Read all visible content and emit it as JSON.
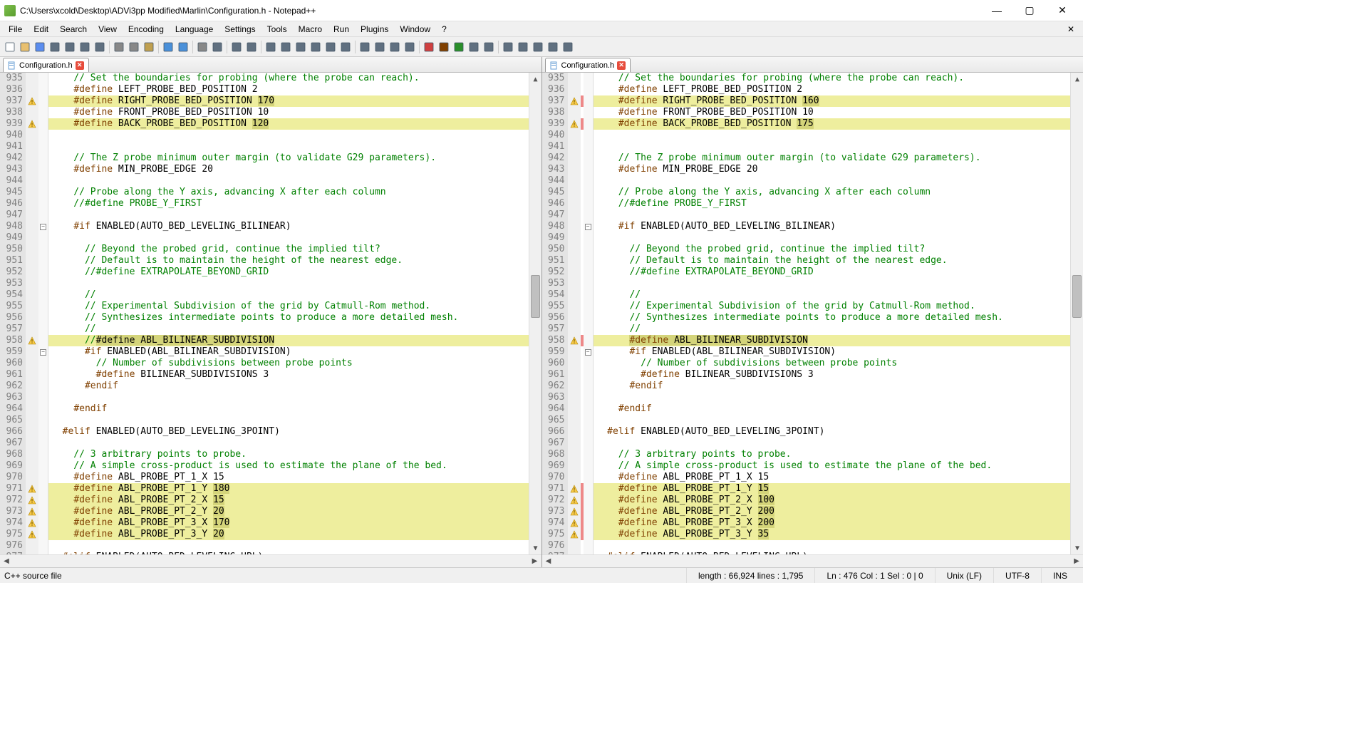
{
  "title": "C:\\Users\\xcold\\Desktop\\ADVi3pp Modified\\Marlin\\Configuration.h - Notepad++",
  "menus": [
    "File",
    "Edit",
    "Search",
    "View",
    "Encoding",
    "Language",
    "Settings",
    "Tools",
    "Macro",
    "Run",
    "Plugins",
    "Window",
    "?"
  ],
  "tab_label": "Configuration.h",
  "status": {
    "filetype": "C++ source file",
    "length": "length : 66,924    lines : 1,795",
    "pos": "Ln : 476   Col : 1   Sel : 0 | 0",
    "eol": "Unix (LF)",
    "enc": "UTF-8",
    "mode": "INS"
  },
  "line_start": 935,
  "line_end": 977,
  "left_lines": [
    {
      "n": 935,
      "t": "comment",
      "text": "    // Set the boundaries for probing (where the probe can reach)."
    },
    {
      "n": 936,
      "t": "define",
      "text": "    #define LEFT_PROBE_BED_POSITION 2"
    },
    {
      "n": 937,
      "t": "define",
      "text": "    #define RIGHT_PROBE_BED_POSITION ",
      "tail": "170",
      "hl": true,
      "warn": true
    },
    {
      "n": 938,
      "t": "define",
      "text": "    #define FRONT_PROBE_BED_POSITION 10"
    },
    {
      "n": 939,
      "t": "define",
      "text": "    #define BACK_PROBE_BED_POSITION ",
      "tail": "120",
      "hl": true,
      "warn": true
    },
    {
      "n": 940,
      "t": "blank",
      "text": ""
    },
    {
      "n": 941,
      "t": "blank",
      "text": ""
    },
    {
      "n": 942,
      "t": "comment",
      "text": "    // The Z probe minimum outer margin (to validate G29 parameters)."
    },
    {
      "n": 943,
      "t": "define",
      "text": "    #define MIN_PROBE_EDGE 20"
    },
    {
      "n": 944,
      "t": "blank",
      "text": ""
    },
    {
      "n": 945,
      "t": "comment",
      "text": "    // Probe along the Y axis, advancing X after each column"
    },
    {
      "n": 946,
      "t": "comment",
      "text": "    //#define PROBE_Y_FIRST"
    },
    {
      "n": 947,
      "t": "blank",
      "text": ""
    },
    {
      "n": 948,
      "t": "pre",
      "text": "    #if ENABLED(AUTO_BED_LEVELING_BILINEAR)",
      "fold": "minus"
    },
    {
      "n": 949,
      "t": "blank",
      "text": ""
    },
    {
      "n": 950,
      "t": "comment",
      "text": "      // Beyond the probed grid, continue the implied tilt?"
    },
    {
      "n": 951,
      "t": "comment",
      "text": "      // Default is to maintain the height of the nearest edge."
    },
    {
      "n": 952,
      "t": "comment",
      "text": "      //#define EXTRAPOLATE_BEYOND_GRID"
    },
    {
      "n": 953,
      "t": "blank",
      "text": ""
    },
    {
      "n": 954,
      "t": "comment",
      "text": "      //"
    },
    {
      "n": 955,
      "t": "comment",
      "text": "      // Experimental Subdivision of the grid by Catmull-Rom method."
    },
    {
      "n": 956,
      "t": "comment",
      "text": "      // Synthesizes intermediate points to produce a more detailed mesh."
    },
    {
      "n": 957,
      "t": "comment",
      "text": "      //"
    },
    {
      "n": 958,
      "t": "comment",
      "text": "      //",
      "tail": "#define ABL_BILINEAR_SUBDIVISION",
      "hl": true,
      "warn": true
    },
    {
      "n": 959,
      "t": "pre",
      "text": "      #if ENABLED(ABL_BILINEAR_SUBDIVISION)",
      "fold": "minus"
    },
    {
      "n": 960,
      "t": "comment",
      "text": "        // Number of subdivisions between probe points"
    },
    {
      "n": 961,
      "t": "define",
      "text": "        #define BILINEAR_SUBDIVISIONS 3"
    },
    {
      "n": 962,
      "t": "pre",
      "text": "      #endif"
    },
    {
      "n": 963,
      "t": "blank",
      "text": ""
    },
    {
      "n": 964,
      "t": "pre",
      "text": "    #endif"
    },
    {
      "n": 965,
      "t": "blank",
      "text": ""
    },
    {
      "n": 966,
      "t": "pre",
      "text": "  #elif ENABLED(AUTO_BED_LEVELING_3POINT)"
    },
    {
      "n": 967,
      "t": "blank",
      "text": ""
    },
    {
      "n": 968,
      "t": "comment",
      "text": "    // 3 arbitrary points to probe."
    },
    {
      "n": 969,
      "t": "comment",
      "text": "    // A simple cross-product is used to estimate the plane of the bed."
    },
    {
      "n": 970,
      "t": "define",
      "text": "    #define ABL_PROBE_PT_1_X 15"
    },
    {
      "n": 971,
      "t": "define",
      "text": "    #define ABL_PROBE_PT_1_Y ",
      "tail": "180",
      "hl": true,
      "warn": true
    },
    {
      "n": 972,
      "t": "define",
      "text": "    #define ABL_PROBE_PT_2_X ",
      "tail": "15",
      "hl": true,
      "warn": true
    },
    {
      "n": 973,
      "t": "define",
      "text": "    #define ABL_PROBE_PT_2_Y ",
      "tail": "20",
      "hl": true,
      "warn": true
    },
    {
      "n": 974,
      "t": "define",
      "text": "    #define ABL_PROBE_PT_3_X ",
      "tail": "170",
      "hl": true,
      "warn": true
    },
    {
      "n": 975,
      "t": "define",
      "text": "    #define ABL_PROBE_PT_3_Y ",
      "tail": "20",
      "hl": true,
      "warn": true
    },
    {
      "n": 976,
      "t": "blank",
      "text": ""
    },
    {
      "n": 977,
      "t": "pre",
      "text": "  #elif ENABLED(AUTO_BED_LEVELING_UBL)"
    }
  ],
  "right_lines": [
    {
      "n": 935,
      "t": "comment",
      "text": "    // Set the boundaries for probing (where the probe can reach)."
    },
    {
      "n": 936,
      "t": "define",
      "text": "    #define LEFT_PROBE_BED_POSITION 2"
    },
    {
      "n": 937,
      "t": "define",
      "text": "    #define RIGHT_PROBE_BED_POSITION ",
      "tail": "160",
      "hl": true,
      "warn": true,
      "cb": true
    },
    {
      "n": 938,
      "t": "define",
      "text": "    #define FRONT_PROBE_BED_POSITION 10"
    },
    {
      "n": 939,
      "t": "define",
      "text": "    #define BACK_PROBE_BED_POSITION ",
      "tail": "175",
      "hl": true,
      "warn": true,
      "cb": true
    },
    {
      "n": 940,
      "t": "blank",
      "text": ""
    },
    {
      "n": 941,
      "t": "blank",
      "text": ""
    },
    {
      "n": 942,
      "t": "comment",
      "text": "    // The Z probe minimum outer margin (to validate G29 parameters)."
    },
    {
      "n": 943,
      "t": "define",
      "text": "    #define MIN_PROBE_EDGE 20"
    },
    {
      "n": 944,
      "t": "blank",
      "text": ""
    },
    {
      "n": 945,
      "t": "comment",
      "text": "    // Probe along the Y axis, advancing X after each column"
    },
    {
      "n": 946,
      "t": "comment",
      "text": "    //#define PROBE_Y_FIRST"
    },
    {
      "n": 947,
      "t": "blank",
      "text": ""
    },
    {
      "n": 948,
      "t": "pre",
      "text": "    #if ENABLED(AUTO_BED_LEVELING_BILINEAR)",
      "fold": "minus"
    },
    {
      "n": 949,
      "t": "blank",
      "text": ""
    },
    {
      "n": 950,
      "t": "comment",
      "text": "      // Beyond the probed grid, continue the implied tilt?"
    },
    {
      "n": 951,
      "t": "comment",
      "text": "      // Default is to maintain the height of the nearest edge."
    },
    {
      "n": 952,
      "t": "comment",
      "text": "      //#define EXTRAPOLATE_BEYOND_GRID"
    },
    {
      "n": 953,
      "t": "blank",
      "text": ""
    },
    {
      "n": 954,
      "t": "comment",
      "text": "      //"
    },
    {
      "n": 955,
      "t": "comment",
      "text": "      // Experimental Subdivision of the grid by Catmull-Rom method."
    },
    {
      "n": 956,
      "t": "comment",
      "text": "      // Synthesizes intermediate points to produce a more detailed mesh."
    },
    {
      "n": 957,
      "t": "comment",
      "text": "      //"
    },
    {
      "n": 958,
      "t": "define",
      "text": "      ",
      "tail": "#define ABL_BILINEAR_SUBDIVISION",
      "hl": true,
      "warn": true,
      "cb": true,
      "tailIsDefine": true
    },
    {
      "n": 959,
      "t": "pre",
      "text": "      #if ENABLED(ABL_BILINEAR_SUBDIVISION)",
      "fold": "minus"
    },
    {
      "n": 960,
      "t": "comment",
      "text": "        // Number of subdivisions between probe points"
    },
    {
      "n": 961,
      "t": "define",
      "text": "        #define BILINEAR_SUBDIVISIONS 3"
    },
    {
      "n": 962,
      "t": "pre",
      "text": "      #endif"
    },
    {
      "n": 963,
      "t": "blank",
      "text": ""
    },
    {
      "n": 964,
      "t": "pre",
      "text": "    #endif"
    },
    {
      "n": 965,
      "t": "blank",
      "text": ""
    },
    {
      "n": 966,
      "t": "pre",
      "text": "  #elif ENABLED(AUTO_BED_LEVELING_3POINT)"
    },
    {
      "n": 967,
      "t": "blank",
      "text": ""
    },
    {
      "n": 968,
      "t": "comment",
      "text": "    // 3 arbitrary points to probe."
    },
    {
      "n": 969,
      "t": "comment",
      "text": "    // A simple cross-product is used to estimate the plane of the bed."
    },
    {
      "n": 970,
      "t": "define",
      "text": "    #define ABL_PROBE_PT_1_X 15"
    },
    {
      "n": 971,
      "t": "define",
      "text": "    #define ABL_PROBE_PT_1_Y ",
      "tail": "15",
      "hl": true,
      "warn": true,
      "cb": true
    },
    {
      "n": 972,
      "t": "define",
      "text": "    #define ABL_PROBE_PT_2_X ",
      "tail": "100",
      "hl": true,
      "warn": true,
      "cb": true
    },
    {
      "n": 973,
      "t": "define",
      "text": "    #define ABL_PROBE_PT_2_Y ",
      "tail": "200",
      "hl": true,
      "warn": true,
      "cb": true
    },
    {
      "n": 974,
      "t": "define",
      "text": "    #define ABL_PROBE_PT_3_X ",
      "tail": "200",
      "hl": true,
      "warn": true,
      "cb": true
    },
    {
      "n": 975,
      "t": "define",
      "text": "    #define ABL_PROBE_PT_3_Y ",
      "tail": "35",
      "hl": true,
      "warn": true,
      "cb": true
    },
    {
      "n": 976,
      "t": "blank",
      "text": ""
    },
    {
      "n": 977,
      "t": "pre",
      "text": "  #elif ENABLED(AUTO_BED_LEVELING_UBL)"
    }
  ],
  "toolbar_icons": [
    "new",
    "open",
    "save",
    "save-all",
    "close",
    "close-all",
    "print",
    "sep",
    "cut",
    "copy",
    "paste",
    "sep",
    "undo",
    "redo",
    "sep",
    "find",
    "replace",
    "sep",
    "zoom-in",
    "zoom-out",
    "sep",
    "sync",
    "wrap",
    "invisible",
    "indent-guide",
    "lang",
    "doc-map",
    "sep",
    "fold-all",
    "unfold-all",
    "fold-level",
    "unfold-level",
    "sep",
    "record",
    "stop",
    "play",
    "play-many",
    "save-macro",
    "sep",
    "compare-prev",
    "compare-next",
    "compare-first",
    "compare-last",
    "compare-reset"
  ]
}
